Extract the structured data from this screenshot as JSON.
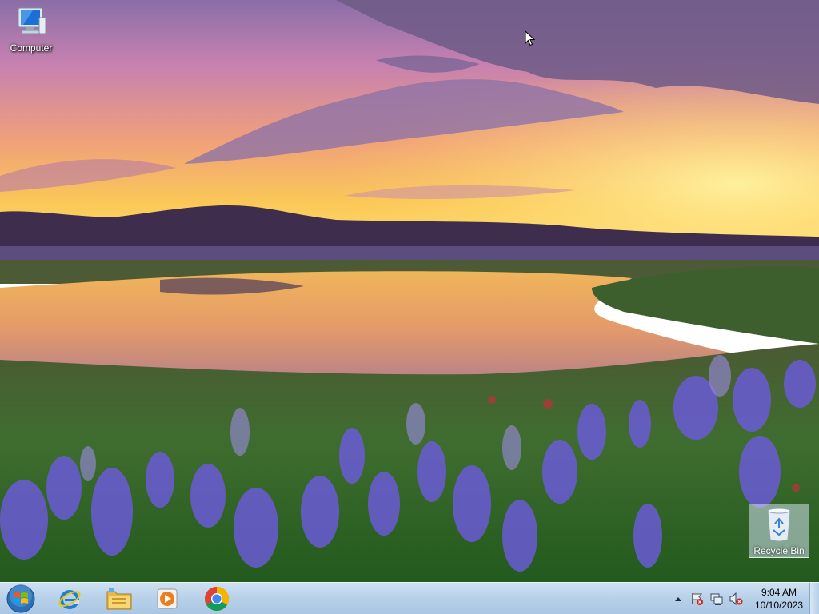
{
  "desktop": {
    "icons": [
      {
        "label": "Computer",
        "icon": "computer-icon"
      },
      {
        "label": "Recycle Bin",
        "icon": "recycle-bin-icon"
      }
    ],
    "wallpaper": "sunset-lake-wildflowers"
  },
  "taskbar": {
    "start": {
      "icon": "windows-logo-icon"
    },
    "pinned": [
      {
        "icon": "internet-explorer-icon"
      },
      {
        "icon": "file-explorer-icon"
      },
      {
        "icon": "media-player-icon"
      },
      {
        "icon": "chrome-icon"
      }
    ],
    "tray": {
      "icons": [
        "show-hidden-icons-arrow",
        "action-center-flag-icon",
        "network-icon",
        "volume-muted-icon"
      ],
      "time": "9:04 AM",
      "date": "10/10/2023"
    }
  },
  "colors": {
    "taskbar": "#b9d2ea",
    "sky_top": "#8a6ea8",
    "sunset": "#f7c94a",
    "flowers": "#6a5bd6"
  }
}
